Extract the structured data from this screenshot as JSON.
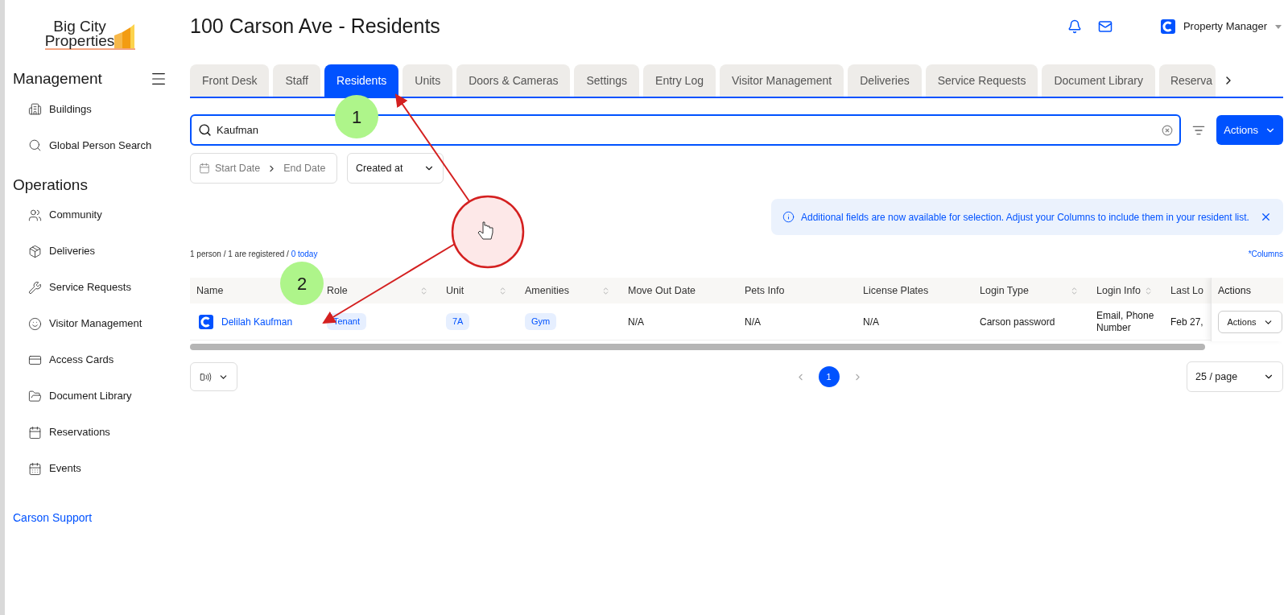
{
  "logo": {
    "line1": "Big City",
    "line2": "Properties"
  },
  "sidebar": {
    "sections": [
      {
        "title": "Management",
        "items": [
          {
            "label": "Buildings"
          },
          {
            "label": "Global Person Search"
          }
        ]
      },
      {
        "title": "Operations",
        "items": [
          {
            "label": "Community"
          },
          {
            "label": "Deliveries"
          },
          {
            "label": "Service Requests"
          },
          {
            "label": "Visitor Management"
          },
          {
            "label": "Access Cards"
          },
          {
            "label": "Document Library"
          },
          {
            "label": "Reservations"
          },
          {
            "label": "Events"
          }
        ]
      }
    ],
    "support_link": "Carson Support"
  },
  "header": {
    "title": "100 Carson Ave - Residents",
    "user": "Property Manager"
  },
  "tabs": [
    {
      "label": "Front Desk",
      "selected": false
    },
    {
      "label": "Staff",
      "selected": false
    },
    {
      "label": "Residents",
      "selected": true
    },
    {
      "label": "Units",
      "selected": false
    },
    {
      "label": "Doors & Cameras",
      "selected": false
    },
    {
      "label": "Settings",
      "selected": false
    },
    {
      "label": "Entry Log",
      "selected": false
    },
    {
      "label": "Visitor Management",
      "selected": false
    },
    {
      "label": "Deliveries",
      "selected": false
    },
    {
      "label": "Service Requests",
      "selected": false
    },
    {
      "label": "Document Library",
      "selected": false
    },
    {
      "label": "Reserva",
      "selected": false
    }
  ],
  "search": {
    "value": "Kaufman"
  },
  "actions_button": "Actions",
  "date_range": {
    "start_placeholder": "Start Date",
    "end_placeholder": "End Date"
  },
  "sort_select": "Created at",
  "banner": "Additional fields are now available for selection. Adjust your Columns to include them in your resident list.",
  "summary": {
    "text": "1 person / 1 are registered / ",
    "link": "0 today"
  },
  "columns_link": "*Columns",
  "table": {
    "columns": [
      {
        "label": "Name"
      },
      {
        "label": "Role",
        "sortable": true
      },
      {
        "label": "Unit",
        "sortable": true
      },
      {
        "label": "Amenities",
        "sortable": true
      },
      {
        "label": "Move Out Date",
        "sortable": false
      },
      {
        "label": "Pets Info",
        "sortable": false
      },
      {
        "label": "License Plates",
        "sortable": false
      },
      {
        "label": "Login Type",
        "sortable": true
      },
      {
        "label": "Login Info",
        "sortable": true
      },
      {
        "label": "Last Lo"
      }
    ],
    "actions_column": "Actions",
    "rows": [
      {
        "name": "Delilah Kaufman",
        "role": "Tenant",
        "unit": "7A",
        "amenities": "Gym",
        "move_out": "N/A",
        "pets": "N/A",
        "plates": "N/A",
        "login_type": "Carson password",
        "login_info": "Email, Phone Number",
        "last_login": "Feb 27,",
        "action": "Actions"
      }
    ]
  },
  "pagination": {
    "pages": [
      {
        "label": "1",
        "selected": true
      }
    ],
    "page_size": "25 / page"
  },
  "annotations": [
    {
      "label": "1"
    },
    {
      "label": "2"
    }
  ]
}
